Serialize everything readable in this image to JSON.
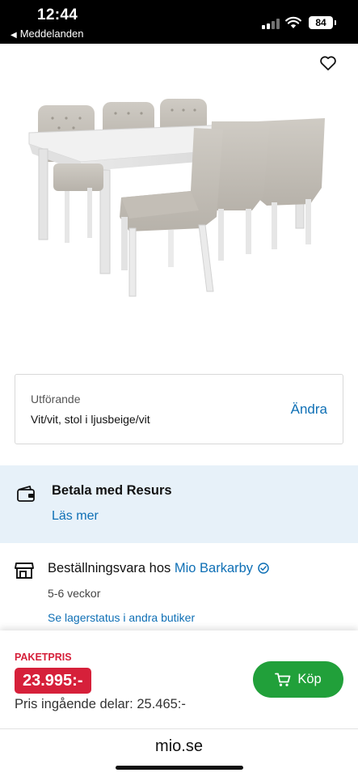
{
  "status_bar": {
    "time": "12:44",
    "back_app": "Meddelanden",
    "battery": "84"
  },
  "product": {
    "image_alt": "Matbord vitt med stolar i ljusbeige"
  },
  "variant": {
    "label": "Utförande",
    "value": "Vit/vit, stol i ljusbeige/vit",
    "change_link": "Ändra"
  },
  "payment": {
    "title": "Betala med Resurs",
    "link": "Läs mer"
  },
  "store": {
    "prefix": "Beställningsvara hos ",
    "name": "Mio Barkarby",
    "delivery_time": "5-6 veckor",
    "stock_link": "Se lagerstatus i andra butiker"
  },
  "pricing": {
    "package_label": "PAKETPRIS",
    "price": "23.995:-",
    "parts_price": "Pris ingående delar: 25.465:-",
    "buy_label": "Köp"
  },
  "browser": {
    "url": "mio.se"
  },
  "colors": {
    "accent_blue": "#0e6fb5",
    "price_red": "#d6203a",
    "buy_green": "#21a03a",
    "info_bg": "#e7f1f9"
  }
}
